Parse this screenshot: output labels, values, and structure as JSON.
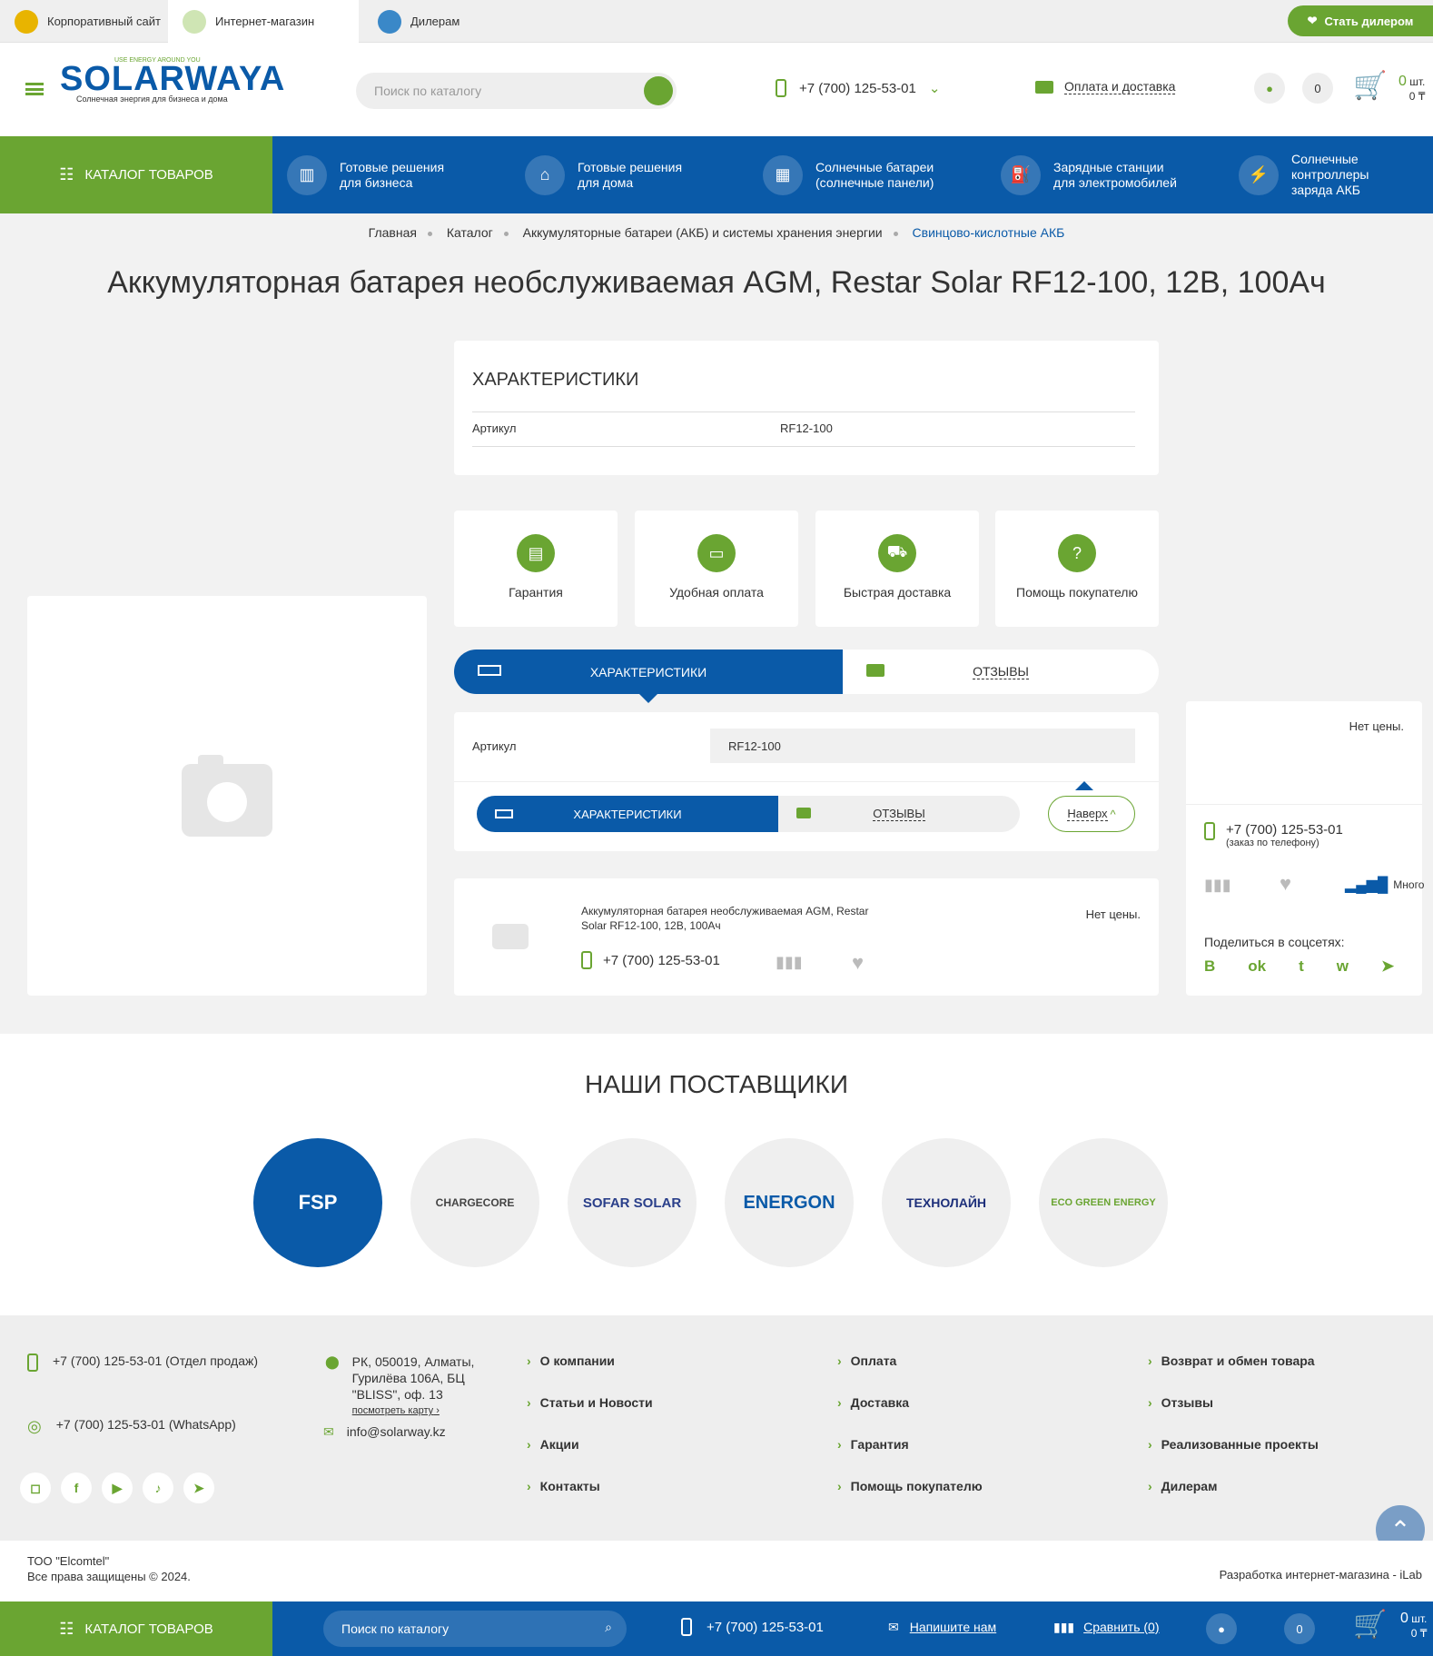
{
  "topbar": {
    "tabs": [
      "Корпоративный сайт",
      "Интернет-магазин",
      "Дилерам"
    ],
    "dealer_btn": "Стать дилером"
  },
  "header": {
    "logo": "SOLARWAYA",
    "logo_tagline": "USE ENERGY AROUND YOU",
    "logo_sub": "Солнечная энергия для бизнеса и дома",
    "search_placeholder": "Поиск по каталогу",
    "phone": "+7 (700) 125-53-01",
    "delivery": "Оплата и доставка",
    "favorites_count": "0",
    "cart_count": "0",
    "cart_unit": "шт.",
    "cart_sum": "0 ₸"
  },
  "nav": {
    "catalog": "Каталог товаров",
    "items": [
      {
        "l1": "Готовые решения",
        "l2": "для бизнеса",
        "l3": ""
      },
      {
        "l1": "Готовые решения",
        "l2": "для дома",
        "l3": ""
      },
      {
        "l1": "Солнечные батареи",
        "l2": "(солнечные панели)",
        "l3": ""
      },
      {
        "l1": "Зарядные станции",
        "l2": "для электромобилей",
        "l3": ""
      },
      {
        "l1": "Солнечные",
        "l2": "контроллеры",
        "l3": "заряда АКБ"
      }
    ]
  },
  "breadcrumbs": [
    "Главная",
    "Каталог",
    "Аккумуляторные батареи (АКБ) и системы хранения энергии",
    "Свинцово-кислотные АКБ"
  ],
  "title": "Аккумуляторная батарея необслуживаемая AGM, Restar Solar RF12-100, 12В, 100Ач",
  "specs": {
    "heading": "Характеристики",
    "label": "Артикул",
    "value": "RF12-100"
  },
  "features": [
    "Гарантия",
    "Удобная оплата",
    "Быстрая доставка",
    "Помощь покупателю"
  ],
  "tabs": {
    "specs": "Характеристики",
    "reviews": "Отзывы",
    "up": "Наверх"
  },
  "mini": {
    "name_l1": "Аккумуляторная батарея необслуживаемая AGM, Restar",
    "name_l2": "Solar RF12-100, 12В, 100Ач",
    "price": "Нет цены.",
    "phone": "+7 (700) 125-53-01"
  },
  "side": {
    "price": "Нет цены.",
    "phone": "+7 (700) 125-53-01",
    "phone_note": "(заказ по телефону)",
    "stock": "Много",
    "share": "Поделиться в соцсетях:"
  },
  "suppliers": {
    "heading": "НАШИ ПОСТАВЩИКИ",
    "items": [
      "FSP",
      "CHARGECORE",
      "SOFAR SOLAR",
      "ENERGON",
      "ТЕХНОЛАЙН",
      "ECO GREEN ENERGY"
    ]
  },
  "footer": {
    "phone_sales": "+7 (700) 125-53-01 (Отдел продаж)",
    "phone_wa": "+7 (700) 125-53-01 (WhatsApp)",
    "addr_l1": "РК, 050019, Алматы,",
    "addr_l2": "Гурилёва 106А, БЦ",
    "addr_l3": "\"BLISS\", оф. 13",
    "map": "посмотреть карту",
    "email": "info@solarway.kz",
    "col1": [
      "О компании",
      "Статьи и Новости",
      "Акции",
      "Контакты"
    ],
    "col2": [
      "Оплата",
      "Доставка",
      "Гарантия",
      "Помощь покупателю"
    ],
    "col3": [
      "Возврат и обмен товара",
      "Отзывы",
      "Реализованные проекты",
      "Дилерам"
    ],
    "company": "ТОО \"Elcomtel\"",
    "rights": "Все права защищены © 2024.",
    "dev": "Разработка интернет-магазина - iLab"
  },
  "bottombar": {
    "catalog": "Каталог товаров",
    "search": "Поиск по каталогу",
    "phone": "+7 (700) 125-53-01",
    "write": "Напишите нам",
    "compare": "Сравнить (0)",
    "fav": "0",
    "cart_count": "0",
    "cart_unit": "шт.",
    "cart_sum": "0 ₸"
  },
  "colors": {
    "green": "#6aa532",
    "blue": "#0a5aa8"
  }
}
